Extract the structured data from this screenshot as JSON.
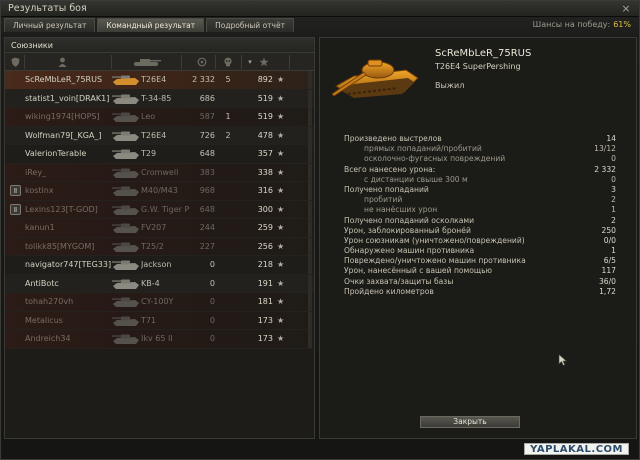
{
  "window": {
    "title": "Результаты боя",
    "close_glyph": "×"
  },
  "tabs": [
    {
      "label": "Личный результат",
      "active": false
    },
    {
      "label": "Командный результат",
      "active": true
    },
    {
      "label": "Подробный отчёт",
      "active": false
    }
  ],
  "win_chance": {
    "label": "Шансы на победу:",
    "value": "61%"
  },
  "team_panel": {
    "title": "Союзники",
    "columns": [
      {
        "icon": "shield-icon"
      },
      {
        "icon": "player-icon"
      },
      {
        "icon": "tank-icon"
      },
      {
        "icon": "target-icon"
      },
      {
        "icon": "skull-icon"
      },
      {
        "icon": "star-icon"
      }
    ],
    "rows": [
      {
        "name": "ScReMbLeR_75RUS",
        "tank": "T26E4",
        "damage": "2 332",
        "kills": "5",
        "xp": "892",
        "star": "★",
        "platoon": "",
        "state": "self"
      },
      {
        "name": "statist1_voin[DRAK1]",
        "tank": "T-34-85",
        "damage": "686",
        "kills": "",
        "xp": "519",
        "star": "★",
        "platoon": "",
        "state": "alive"
      },
      {
        "name": "wiking1974[HOPS]",
        "tank": "Leo",
        "damage": "587",
        "kills": "1",
        "xp": "519",
        "star": "★",
        "platoon": "",
        "state": "dead"
      },
      {
        "name": "Wolfman79[_KGA_]",
        "tank": "T26E4",
        "damage": "726",
        "kills": "2",
        "xp": "478",
        "star": "★",
        "platoon": "",
        "state": "alive"
      },
      {
        "name": "ValerionTerable",
        "tank": "T29",
        "damage": "648",
        "kills": "",
        "xp": "357",
        "star": "★",
        "platoon": "",
        "state": "alive"
      },
      {
        "name": "iRey_",
        "tank": "Cromwell",
        "damage": "383",
        "kills": "",
        "xp": "338",
        "star": "★",
        "platoon": "",
        "state": "dead"
      },
      {
        "name": "kostinx",
        "tank": "M40/M43",
        "damage": "968",
        "kills": "",
        "xp": "316",
        "star": "★",
        "platoon": "Ⅱ",
        "state": "dead"
      },
      {
        "name": "Lexins123[T-GOD]",
        "tank": "G.W. Tiger P",
        "damage": "648",
        "kills": "",
        "xp": "300",
        "star": "★",
        "platoon": "Ⅱ",
        "state": "dead"
      },
      {
        "name": "kanun1",
        "tank": "FV207",
        "damage": "244",
        "kills": "",
        "xp": "259",
        "star": "★",
        "platoon": "",
        "state": "dead"
      },
      {
        "name": "tolikk85[MYGOM]",
        "tank": "T25/2",
        "damage": "227",
        "kills": "",
        "xp": "256",
        "star": "★",
        "platoon": "",
        "state": "dead"
      },
      {
        "name": "navigator747[TEG33]",
        "tank": "Jackson",
        "damage": "0",
        "kills": "",
        "xp": "218",
        "star": "★",
        "platoon": "",
        "state": "alive"
      },
      {
        "name": "AntiBotc",
        "tank": "KB-4",
        "damage": "0",
        "kills": "",
        "xp": "191",
        "star": "★",
        "platoon": "",
        "state": "alive"
      },
      {
        "name": "tohah270vh",
        "tank": "CY-100Y",
        "damage": "0",
        "kills": "",
        "xp": "181",
        "star": "★",
        "platoon": "",
        "state": "dead"
      },
      {
        "name": "Metalicus",
        "tank": "T71",
        "damage": "0",
        "kills": "",
        "xp": "173",
        "star": "★",
        "platoon": "",
        "state": "dead"
      },
      {
        "name": "Andreich34",
        "tank": "Ikv 65 II",
        "damage": "0",
        "kills": "",
        "xp": "173",
        "star": "★",
        "platoon": "",
        "state": "dead"
      }
    ]
  },
  "detail": {
    "player_name": "ScReMbLeR_75RUS",
    "tank_full_name": "T26E4 SuperPershing",
    "status": "Выжил",
    "stats": [
      {
        "label": "Произведено выстрелов",
        "value": "14",
        "sub": false
      },
      {
        "label": "прямых попаданий/пробитий",
        "value": "13/12",
        "sub": true
      },
      {
        "label": "осколочно-фугасных повреждений",
        "value": "0",
        "sub": true
      },
      {
        "label": "Всего нанесено урона:",
        "value": "2 332",
        "sub": false
      },
      {
        "label": "с дистанции свыше 300 м",
        "value": "0",
        "sub": true
      },
      {
        "label": "Получено попаданий",
        "value": "3",
        "sub": false
      },
      {
        "label": "пробитий",
        "value": "2",
        "sub": true
      },
      {
        "label": "не нанёсших урон",
        "value": "1",
        "sub": true
      },
      {
        "label": "Получено попаданий осколками",
        "value": "2",
        "sub": false
      },
      {
        "label": "Урон, заблокированный бронёй",
        "value": "250",
        "sub": false
      },
      {
        "label": "Урон союзникам (уничтожено/повреждений)",
        "value": "0/0",
        "sub": false
      },
      {
        "label": "Обнаружено машин противника",
        "value": "1",
        "sub": false
      },
      {
        "label": "Повреждено/уничтожено машин противника",
        "value": "6/5",
        "sub": false
      },
      {
        "label": "Урон, нанесённый с вашей помощью",
        "value": "117",
        "sub": false
      },
      {
        "label": "Очки захвата/защиты базы",
        "value": "36/0",
        "sub": false
      },
      {
        "label": "Пройдено километров",
        "value": "1,72",
        "sub": false
      }
    ],
    "close_button": "Закрыть"
  },
  "watermark": "YAPLAKAL.COM",
  "colors": {
    "accent": "#d9c247",
    "self_row": "#4a2a1a",
    "dead_row": "#2c1b16"
  }
}
